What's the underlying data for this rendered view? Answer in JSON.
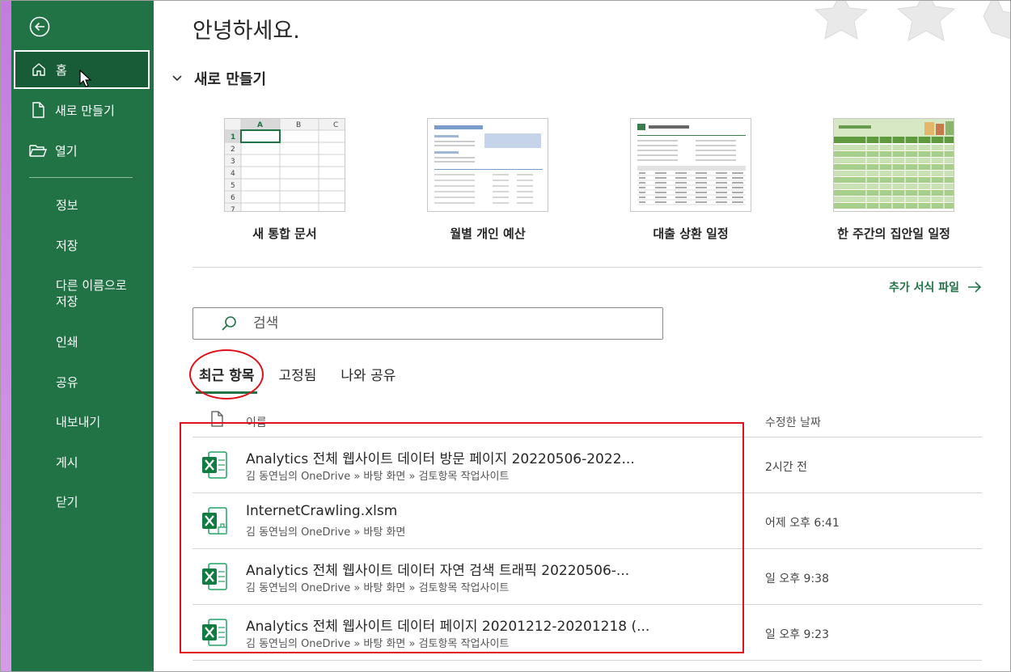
{
  "sidebar": {
    "items": [
      {
        "label": "홈",
        "icon": "home-icon"
      },
      {
        "label": "새로 만들기",
        "icon": "new-file-icon"
      },
      {
        "label": "열기",
        "icon": "folder-open-icon"
      }
    ],
    "sub_items": [
      "정보",
      "저장",
      "다른 이름으로\n저장",
      "인쇄",
      "공유",
      "내보내기",
      "게시",
      "닫기"
    ]
  },
  "main": {
    "greeting": "안녕하세요.",
    "new_section_title": "새로 만들기",
    "templates": [
      {
        "label": "새 통합 문서"
      },
      {
        "label": "월별 개인 예산"
      },
      {
        "label": "대출 상환 일정"
      },
      {
        "label": "한 주간의 집안일 일정"
      }
    ],
    "more_templates": "추가 서식 파일",
    "search_placeholder": "검색",
    "tabs": [
      "최근 항목",
      "고정됨",
      "나와 공유"
    ],
    "list_header": {
      "name": "이름",
      "date": "수정한 날짜"
    },
    "files": [
      {
        "title": "Analytics 전체 웹사이트 데이터 방문 페이지 20220506-2022...",
        "path": "김 동연님의 OneDrive » 바탕 화면 » 검토항목 작업사이트",
        "date": "2시간 전"
      },
      {
        "title": "InternetCrawling.xlsm",
        "path": "김 동연님의 OneDrive » 바탕 화면",
        "date": "어제 오후 6:41"
      },
      {
        "title": "Analytics 전체 웹사이트 데이터 자연 검색 트래픽 20220506-...",
        "path": "김 동연님의 OneDrive » 바탕 화면 » 검토항목 작업사이트",
        "date": "일 오후 9:38"
      },
      {
        "title": "Analytics 전체 웹사이트 데이터 페이지 20201212-20201218 (...",
        "path": "김 동연님의 OneDrive » 바탕 화면 » 검토항목 작업사이트",
        "date": "일 오후 9:23"
      }
    ]
  },
  "template_thumbs": {
    "blank_cols": [
      "A",
      "B",
      "C"
    ],
    "blank_rows": [
      "1",
      "2",
      "3",
      "4",
      "5",
      "6",
      "7"
    ]
  },
  "colors": {
    "accent": "#217346",
    "sidebar": "#217346",
    "annotation": "#e0101c"
  }
}
